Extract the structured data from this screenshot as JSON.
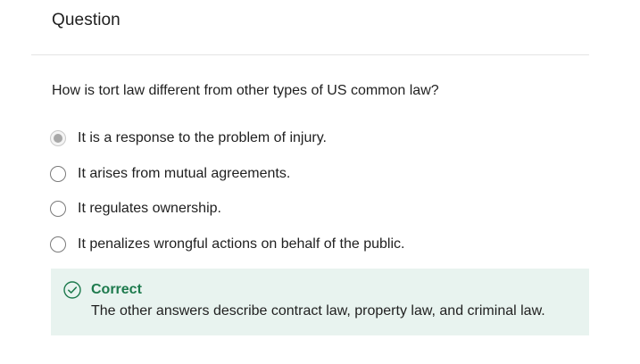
{
  "header": {
    "title": "Question"
  },
  "question": {
    "prompt": "How is tort law different from other types of US common law?",
    "options": [
      {
        "label": "It is a response to the problem of injury.",
        "selected": true
      },
      {
        "label": "It arises from mutual agreements.",
        "selected": false
      },
      {
        "label": "It regulates ownership.",
        "selected": false
      },
      {
        "label": "It penalizes wrongful actions on behalf of the public.",
        "selected": false
      }
    ]
  },
  "feedback": {
    "status": "Correct",
    "message": "The other answers describe contract law, property law, and criminal law.",
    "icon": "check-circle-icon",
    "accent_color": "#1d7a4d",
    "background_color": "#e8f3ef"
  }
}
